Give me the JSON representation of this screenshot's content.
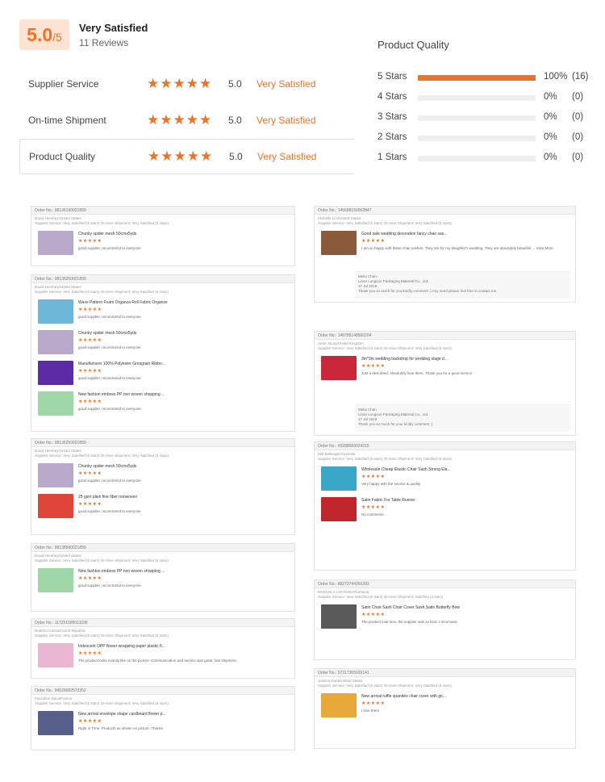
{
  "summary": {
    "score": "5.0",
    "out_of": "/5",
    "title": "Very Satisfied",
    "reviews": "11 Reviews"
  },
  "ratings": [
    {
      "label": "Supplier Service",
      "value": "5.0",
      "text": "Very Satisfied"
    },
    {
      "label": "On-time Shipment",
      "value": "5.0",
      "text": "Very Satisfied"
    },
    {
      "label": "Product Quality",
      "value": "5.0",
      "text": "Very Satisfied"
    }
  ],
  "product_quality": {
    "title": "Product Quality",
    "rows": [
      {
        "label": "5 Stars",
        "pct": "100%",
        "count": "(16)",
        "fill": 1.0
      },
      {
        "label": "4 Stars",
        "pct": "0%",
        "count": "(0)",
        "fill": 0
      },
      {
        "label": "3 Stars",
        "pct": "0%",
        "count": "(0)",
        "fill": 0
      },
      {
        "label": "2 Stars",
        "pct": "0%",
        "count": "(0)",
        "fill": 0
      },
      {
        "label": "1 Stars",
        "pct": "0%",
        "count": "(0)",
        "fill": 0
      }
    ]
  },
  "stars_glyph": "★★★★★",
  "colors": {
    "accent": "#f07224"
  },
  "left_cards": [
    {
      "order": "Order No.: 98136190021899",
      "reviewer": "David Hershey/United States",
      "meta": "Supplier Service: Very Satisfied (5 stars)  On-time Shipment: Very Satisfied (5 stars)",
      "items": [
        {
          "name": "Chunky spider mesh 50cmx5yds",
          "comment": "good supplier, recommend to everyone",
          "color": "#b8a9c8"
        }
      ]
    },
    {
      "order": "Order No.: 98136250021899",
      "reviewer": "David Hershey/United States",
      "meta": "Supplier Service: Very Satisfied (5 stars)  On-time Shipment: Very Satisfied (5 stars)",
      "items": [
        {
          "name": "Wave Pattern Foam Organza Roll Fabric Organze",
          "comment": "good supplier, recommend to everyone",
          "color": "#6fb7d8"
        },
        {
          "name": "Chunky spider mesh 50cmx5yds",
          "comment": "good supplier, recommend to everyone",
          "color": "#b8a9c8"
        },
        {
          "name": "Manufacturer 100% Polyester Grosgrain Ribbo...",
          "comment": "good supplier, recommend to everyone",
          "color": "#5b2ca6"
        },
        {
          "name": "New fashion emboss PP non woven shopping ...",
          "comment": "good supplier, recommend to everyone",
          "color": "#9ed6a8"
        }
      ]
    },
    {
      "order": "Order No.: 98136250021899",
      "reviewer": "David Hershey/United States",
      "meta": "Supplier Service: Very Satisfied (5 stars)  On-time Shipment: Very Satisfied (5 stars)",
      "items": [
        {
          "name": "Chunky spider mesh 50cmx5yds",
          "comment": "good supplier, recommend to everyone",
          "color": "#b8a9c8"
        },
        {
          "name": "25 gsm plain fine fiber nonwoven",
          "comment": "good supplier, recommend to everyone",
          "color": "#e0453a"
        }
      ]
    },
    {
      "order": "Order No.: 98138580021899",
      "reviewer": "David Hershey/United States",
      "meta": "Supplier Service: Very Satisfied (5 stars)  On-time Shipment: Very Satisfied (5 stars)",
      "items": [
        {
          "name": "New fashion emboss PP non woven shopping ...",
          "comment": "good supplier, recommend to everyone",
          "color": "#9ed6a8"
        }
      ]
    },
    {
      "order": "Order No.: 117251585011036",
      "reviewer": "Roberto Carlos/Czech Republic",
      "meta": "Supplier Service: Very Satisfied (5 stars)  On-time Shipment: Very Satisfied (5 stars)",
      "items": [
        {
          "name": "Iridescent OPP flower wrapping paper plastic fl...",
          "comment": "The product looks exactly like on the picture. Communication and service was great, fast shipment",
          "color": "#e9b7cf"
        }
      ]
    },
    {
      "order": "Order No.: 94526682572352",
      "reviewer": "Pascaline Baca/France",
      "meta": "Supplier Service: Very Satisfied (5 stars)  On-time Shipment: Very Satisfied (5 stars)",
      "items": [
        {
          "name": "New arrival envelope shape cardboard flower p...",
          "comment": "Right in Time. Products as shown on picture. Thanks",
          "color": "#56608a"
        }
      ]
    }
  ],
  "right_cards": [
    {
      "order": "Order No.: 145688150002847",
      "reviewer": "Michelle Lim/United States",
      "meta": "Supplier Service: Very Satisfied (5 stars)  On-time Shipment: Very Satisfied (5 stars)",
      "items": [
        {
          "name": "Good sale wedding decoration fancy chair sas...",
          "comment": "I am so happy with these chair sashes. They are for my daughter's wedding. They are absolutely beautiful ... View More",
          "color": "#8a5a3a"
        }
      ],
      "reply": {
        "name": "Melia Chan",
        "company": "Linan Longxun Packaging Material Co., Ltd.",
        "date": "17 Jul 2019",
        "text": "Thank you so much for you kindly comment :) Any need please feel free to contact me"
      }
    },
    {
      "order": "Order No.: 148785148500204",
      "reviewer": "Anne Jacay/United Kingdom",
      "meta": "Supplier Service: Very Satisfied (5 stars)  On-time Shipment: Very Satisfied (5 stars)",
      "items": [
        {
          "name": "3m*3m wedding backdrop for wedding stage d...",
          "comment": "Just a described. Absolutely love them. Thank you for a good service",
          "color": "#c8283a"
        }
      ],
      "reply": {
        "name": "Melia Chan",
        "company": "Linan Longxun Packaging Material Co., Ltd.",
        "date": "17 Jul 2019",
        "text": "Thank you so much for your kindly comment :)"
      }
    },
    {
      "order": "Order No.: 93288083024215",
      "reviewer": "Mel Bellenger/Australia",
      "meta": "Supplier Service: Very Satisfied (5 stars)  On-time Shipment: Very Satisfied (5 stars)",
      "items": [
        {
          "name": "Wholesale Cheap Elastic Chair Sash Strong Ela...",
          "comment": "Very happy with the service & quality",
          "color": "#3aa7c9"
        },
        {
          "name": "Satin Fabric For Table Runner",
          "comment": "No comments",
          "color": "#c0262c"
        }
      ]
    },
    {
      "order": "Order No.: 88273744260393",
      "reviewer": "MARCELA LAFONDA/Romania",
      "meta": "Supplier Service: Very Satisfied (5 stars)  On-time Shipment: Satisfied (4 stars)",
      "items": [
        {
          "name": "Satin Chair Sash Chair Cover Sash,Satin Butterfly Bow",
          "comment": "The product look nice, the supplier was so kind. I recomand",
          "color": "#5a5a5a"
        }
      ]
    },
    {
      "order": "Order No.: 97317365920141",
      "reviewer": "Jessica Hardt/United States",
      "meta": "Supplier Service: Very Satisfied (5 stars)  On-time Shipment: Very Satisfied (5 stars)",
      "items": [
        {
          "name": "New arrival ruffle spandex chair cover with go...",
          "comment": "I love them",
          "color": "#e8a93a"
        }
      ]
    }
  ]
}
